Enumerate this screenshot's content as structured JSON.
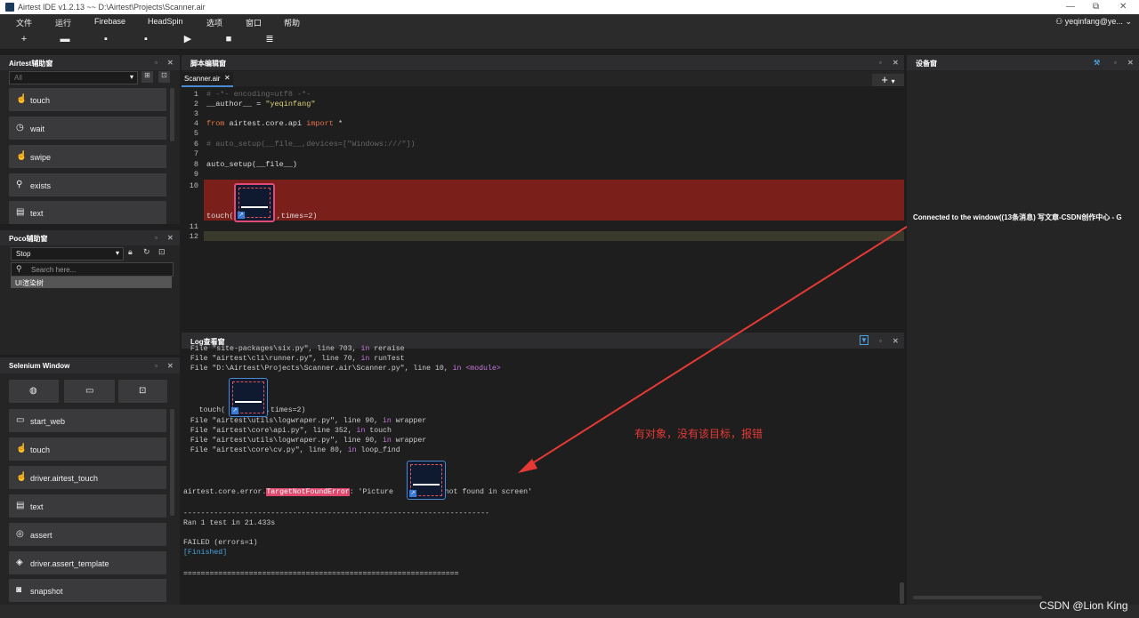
{
  "window": {
    "title": "Airtest IDE v1.2.13 ~~ D:\\Airtest\\Projects\\Scanner.air",
    "controls": [
      "—",
      "⧉",
      "✕"
    ]
  },
  "menu": [
    "文件",
    "运行",
    "Firebase",
    "HeadSpin",
    "选项",
    "窗口",
    "帮助"
  ],
  "user": {
    "name": "yeqinfang@ye..."
  },
  "airtest_panel": {
    "title": "Airtest辅助窗",
    "filter_value": "All",
    "tools": [
      {
        "label": "touch",
        "icon": "touch-icon"
      },
      {
        "label": "wait",
        "icon": "clock-icon"
      },
      {
        "label": "swipe",
        "icon": "swipe-icon"
      },
      {
        "label": "exists",
        "icon": "search-icon"
      },
      {
        "label": "text",
        "icon": "text-icon"
      }
    ]
  },
  "poco_panel": {
    "title": "Poco辅助窗",
    "select_value": "Stop",
    "search_placeholder": "Search here...",
    "tree_root": "UI渲染树"
  },
  "selenium_panel": {
    "title": "Selenium Window",
    "tools": [
      "start_web",
      "touch",
      "driver.airtest_touch",
      "text",
      "assert",
      "driver.assert_template",
      "snapshot"
    ]
  },
  "editor": {
    "panel_title": "脚本编辑窗",
    "tab_label": "Scanner.air",
    "lines": [
      {
        "n": "1",
        "parts": [
          {
            "t": "# -*- encoding=utf8 -*-",
            "c": "cm"
          }
        ]
      },
      {
        "n": "2",
        "parts": [
          {
            "t": "__author__ = ",
            "c": "pl"
          },
          {
            "t": "\"yeqinfang\"",
            "c": "st"
          }
        ]
      },
      {
        "n": "3",
        "parts": []
      },
      {
        "n": "4",
        "parts": [
          {
            "t": "from ",
            "c": "kw"
          },
          {
            "t": "airtest.core.api ",
            "c": "pl"
          },
          {
            "t": "import ",
            "c": "kw"
          },
          {
            "t": "*",
            "c": "pl"
          }
        ]
      },
      {
        "n": "5",
        "parts": []
      },
      {
        "n": "6",
        "parts": [
          {
            "t": "# auto_setup(__file__,devices=[\"Windows:///\"])",
            "c": "cm"
          }
        ]
      },
      {
        "n": "7",
        "parts": []
      },
      {
        "n": "8",
        "parts": [
          {
            "t": "auto_setup(__file__)",
            "c": "pl"
          }
        ]
      },
      {
        "n": "9",
        "parts": []
      }
    ],
    "line10_num": "10",
    "line10_pre": "touch(",
    "line10_post": ",times=2)",
    "line11_num": "11",
    "line12_num": "12"
  },
  "log": {
    "panel_title": "Log查看窗",
    "lines_top": [
      "  File \"site-packages\\six.py\", line 703, in reraise",
      "  File \"airtest\\cli\\runner.py\", line 70, in runTest",
      "  File \"D:\\Airtest\\Projects\\Scanner.air\\Scanner.py\", line 10, in <module>"
    ],
    "touch_pre": "    touch(",
    "touch_post": ",times=2)",
    "lines_mid": [
      "  File \"airtest\\utils\\logwraper.py\", line 90, in wrapper",
      "  File \"airtest\\core\\api.py\", line 352, in touch",
      "  File \"airtest\\utils\\logwraper.py\", line 90, in wrapper",
      "  File \"airtest\\core\\cv.py\", line 80, in loop_find"
    ],
    "error_prefix": "airtest.core.error.",
    "error_name": "TargetNotFoundError",
    "error_mid": ": 'Picture ",
    "error_tail": " not found in screen'",
    "separator": "----------------------------------------------------------------------",
    "ran": "Ran 1 test in 21.433s",
    "failed": "FAILED (errors=1)",
    "finished": "[Finished]",
    "separator2": "======================================================================"
  },
  "annotation": {
    "text": "有对象，没有该目标，报错",
    "color": "#e53935"
  },
  "device_panel": {
    "title": "设备窗",
    "connected_text": "Connected to the window((13条消息) 写文章-CSDN创作中心 - G"
  },
  "watermark": "CSDN @Lion King",
  "colors": {
    "error_highlight": "#7a1f1a",
    "current_line": "#3a3a2c",
    "error_tag": "#e04a6e"
  }
}
